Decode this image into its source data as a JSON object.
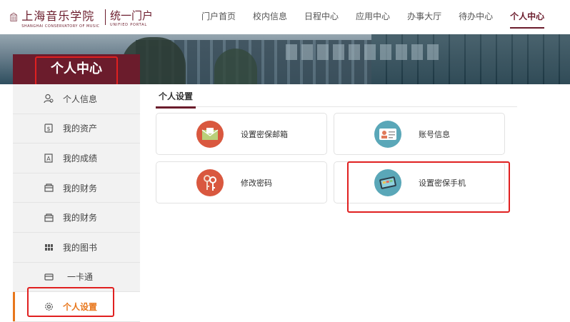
{
  "logo": {
    "school_cn": "上海音乐学院",
    "school_en": "SHANGHAI CONSERVATORY OF MUSIC",
    "portal_cn": "统一门户",
    "portal_en": "UNIFIED PORTAL"
  },
  "nav": {
    "items": [
      {
        "label": "门户首页"
      },
      {
        "label": "校内信息"
      },
      {
        "label": "日程中心"
      },
      {
        "label": "应用中心"
      },
      {
        "label": "办事大厅"
      },
      {
        "label": "待办中心"
      },
      {
        "label": "个人中心",
        "active": true
      }
    ]
  },
  "sidebar": {
    "title": "个人中心",
    "items": [
      {
        "label": "个人信息",
        "icon": "user-icon"
      },
      {
        "label": "我的资产",
        "icon": "asset-icon"
      },
      {
        "label": "我的成绩",
        "icon": "grade-icon"
      },
      {
        "label": "我的财务",
        "icon": "finance-icon"
      },
      {
        "label": "我的财务",
        "icon": "finance-icon"
      },
      {
        "label": "我的图书",
        "icon": "books-icon"
      },
      {
        "label": "一卡通",
        "icon": "card-icon"
      },
      {
        "label": "个人设置",
        "icon": "gear-icon",
        "active": true
      }
    ]
  },
  "content": {
    "tab": "个人设置",
    "cards": [
      {
        "label": "设置密保邮箱",
        "icon": "envelope-icon",
        "color": "#d9583f"
      },
      {
        "label": "账号信息",
        "icon": "id-card-icon",
        "color": "#5aa7b8"
      },
      {
        "label": "修改密码",
        "icon": "keys-icon",
        "color": "#d9583f"
      },
      {
        "label": "设置密保手机",
        "icon": "phone-icon",
        "color": "#5aa7b8"
      }
    ]
  },
  "colors": {
    "brand": "#6b1c2c",
    "active_accent": "#e8771c",
    "highlight_box": "#e02020"
  }
}
